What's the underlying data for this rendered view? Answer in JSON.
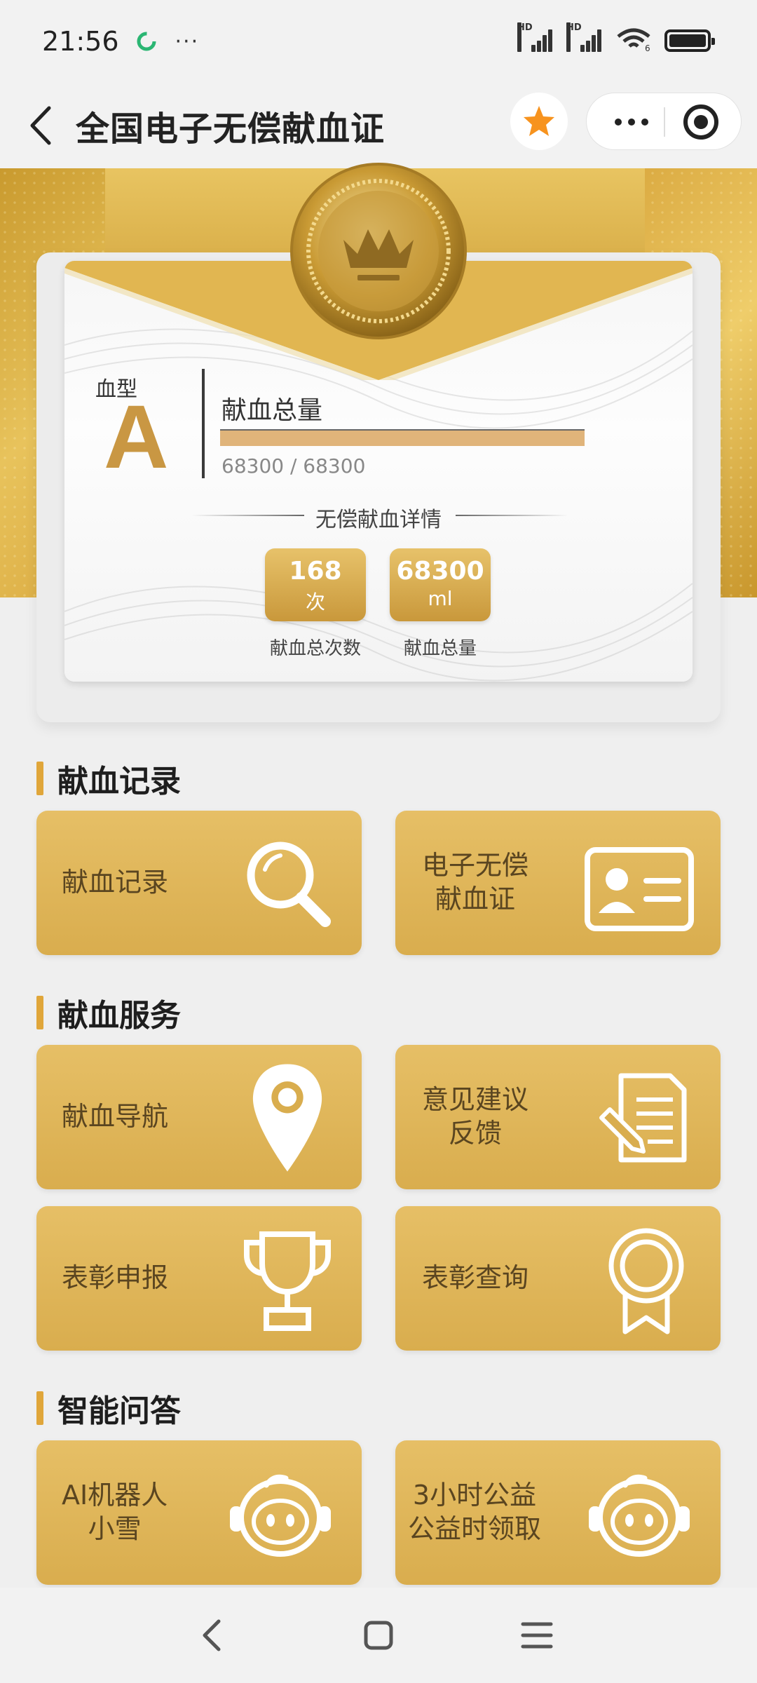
{
  "status_bar": {
    "time": "21:56",
    "dots": "···",
    "signal1_label": "HD",
    "signal2_label": "HD",
    "wifi_label": "6"
  },
  "nav": {
    "title": "全国电子无偿献血证",
    "star_color": "#f7931e"
  },
  "card": {
    "blood_label": "血型",
    "blood_type": "A",
    "total_label": "献血总量",
    "progress_text": "68300 / 68300",
    "progress_fraction": 1.0,
    "detail_title": "无偿献血详情",
    "stats": [
      {
        "value": "168",
        "unit": "次",
        "caption": "献血总次数"
      },
      {
        "value": "68300",
        "unit": "ml",
        "caption": "献血总量"
      }
    ]
  },
  "sections": {
    "records": {
      "title": "献血记录",
      "tiles": [
        {
          "label": "献血记录",
          "icon": "search-icon"
        },
        {
          "label_line1": "电子无偿",
          "label_line2": "献血证",
          "icon": "id-card-icon"
        }
      ]
    },
    "services": {
      "title": "献血服务",
      "tiles": [
        {
          "label": "献血导航",
          "icon": "location-pin-icon"
        },
        {
          "label_line1": "意见建议",
          "label_line2": "反馈",
          "icon": "document-edit-icon"
        },
        {
          "label": "表彰申报",
          "icon": "trophy-icon"
        },
        {
          "label": "表彰查询",
          "icon": "award-ribbon-icon"
        }
      ]
    },
    "qa": {
      "title": "智能问答",
      "tiles": [
        {
          "label_line1": "AI机器人",
          "label_line2": "小雪",
          "icon": "robot-icon"
        },
        {
          "label_line1": "3小时公益",
          "label_line2": "公益时领取",
          "icon": "robot-icon"
        }
      ]
    }
  },
  "colors": {
    "gold": "#d9ad4e",
    "accent_bar": "#e0a63a"
  }
}
